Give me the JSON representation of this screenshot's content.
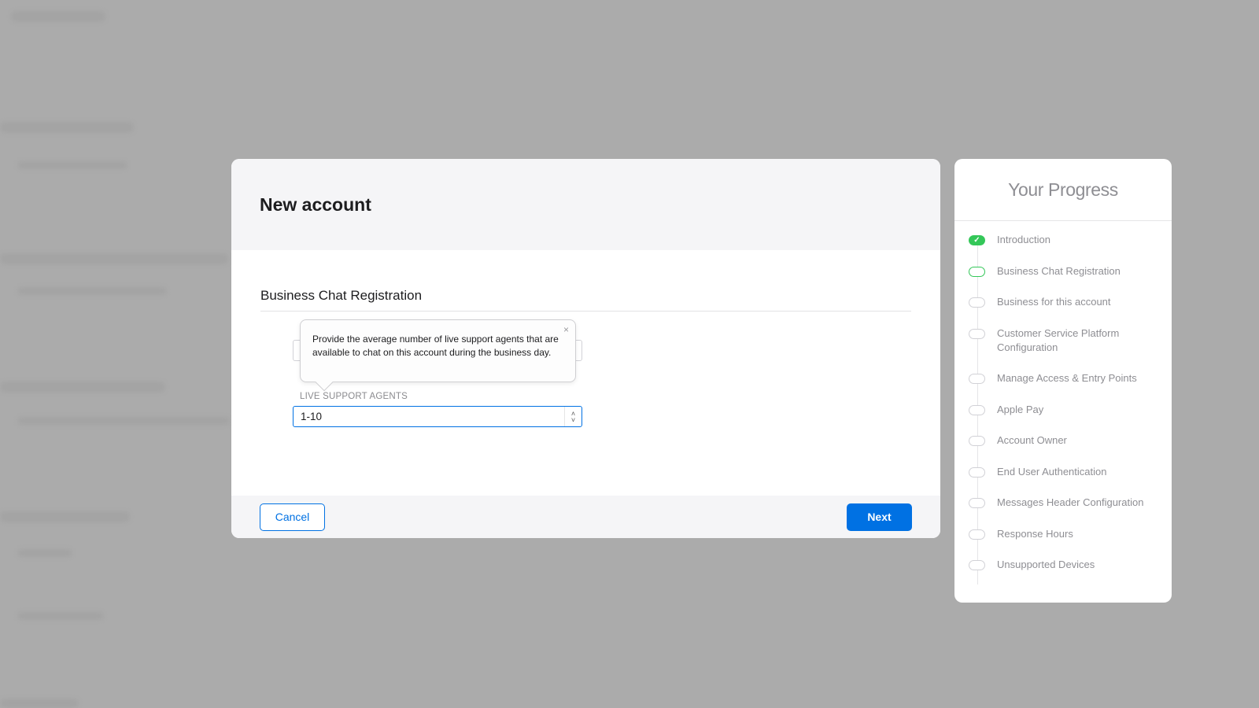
{
  "modal": {
    "title": "New account",
    "section_title": "Business Chat Registration",
    "tooltip_text": "Provide the average number of live support agents that are available to chat on this account during the business day.",
    "tooltip_close": "×",
    "field_label": "LIVE SUPPORT AGENTS",
    "field_value": "1-10",
    "cancel_label": "Cancel",
    "next_label": "Next"
  },
  "progress": {
    "title": "Your Progress",
    "steps": [
      {
        "label": "Introduction",
        "state": "done"
      },
      {
        "label": "Business Chat Registration",
        "state": "current"
      },
      {
        "label": "Business for this account",
        "state": "pending"
      },
      {
        "label": "Customer Service Platform Configuration",
        "state": "pending"
      },
      {
        "label": "Manage Access & Entry Points",
        "state": "pending"
      },
      {
        "label": "Apple Pay",
        "state": "pending"
      },
      {
        "label": "Account Owner",
        "state": "pending"
      },
      {
        "label": "End User Authentication",
        "state": "pending"
      },
      {
        "label": "Messages Header Configuration",
        "state": "pending"
      },
      {
        "label": "Response Hours",
        "state": "pending"
      },
      {
        "label": "Unsupported Devices",
        "state": "pending"
      }
    ]
  },
  "colors": {
    "accent": "#0071e3",
    "success": "#34c759",
    "overlay": "#ababab"
  }
}
